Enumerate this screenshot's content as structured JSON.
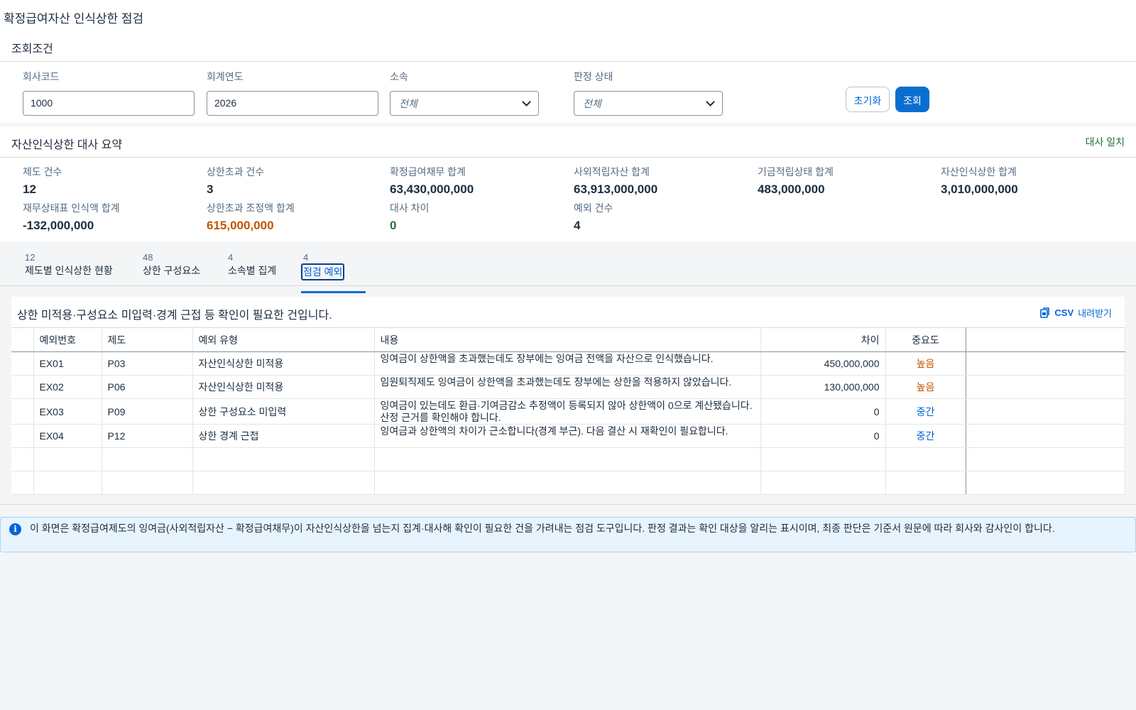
{
  "app": {
    "title": "확정급여자산 인식상한 점검"
  },
  "filters": {
    "heading": "조회조건",
    "company_code": {
      "label": "회사코드",
      "value": "1000"
    },
    "fiscal_year": {
      "label": "회계연도",
      "value": "2026"
    },
    "division": {
      "label": "소속",
      "value": "전체"
    },
    "status": {
      "label": "판정 상태",
      "value": "전체"
    },
    "reset_label": "초기화",
    "search_label": "조회"
  },
  "summary": {
    "heading": "자산인식상한 대사 요약",
    "status": "대사 일치",
    "kpis": [
      {
        "label": "제도 건수",
        "value": "12"
      },
      {
        "label": "상한초과 건수",
        "value": "3"
      },
      {
        "label": "확정급여채무 합계",
        "value": "63,430,000,000"
      },
      {
        "label": "사외적립자산 합계",
        "value": "63,913,000,000"
      },
      {
        "label": "기금적립상태 합계",
        "value": "483,000,000"
      },
      {
        "label": "자산인식상한 합계",
        "value": "3,010,000,000"
      },
      {
        "label": "재무상태표 인식액 합계",
        "value": "-132,000,000"
      },
      {
        "label": "상한초과 조정액 합계",
        "value": "615,000,000"
      },
      {
        "label": "대사 차이",
        "value": "0"
      },
      {
        "label": "예외 건수",
        "value": "4"
      }
    ]
  },
  "tabs": [
    {
      "count": "12",
      "label": "제도별 인식상한 현황"
    },
    {
      "count": "48",
      "label": "상한 구성요소"
    },
    {
      "count": "4",
      "label": "소속별 집계"
    },
    {
      "count": "4",
      "label": "점검 예외"
    }
  ],
  "exceptions": {
    "description": "상한 미적용·구성요소 미입력·경계 근접 등 확인이 필요한 건입니다.",
    "csv_icon_label": "CSV",
    "csv_label": "내려받기",
    "columns": [
      "예외번호",
      "제도",
      "예외 유형",
      "내용",
      "차이",
      "중요도"
    ],
    "rows": [
      {
        "id": "EX01",
        "plan": "P03",
        "type": "자산인식상한 미적용",
        "content": "잉여금이 상한액을 초과했는데도 장부에는 잉여금 전액을 자산으로 인식했습니다.",
        "diff": "450,000,000",
        "severity": "높음"
      },
      {
        "id": "EX02",
        "plan": "P06",
        "type": "자산인식상한 미적용",
        "content": "임원퇴직제도 잉여금이 상한액을 초과했는데도 장부에는 상한을 적용하지 않았습니다.",
        "diff": "130,000,000",
        "severity": "높음"
      },
      {
        "id": "EX03",
        "plan": "P09",
        "type": "상한 구성요소 미입력",
        "content": "잉여금이 있는데도 환급·기여금감소 추정액이 등록되지 않아 상한액이 0으로 계산됐습니다. 산정 근거를 확인해야 합니다.",
        "diff": "0",
        "severity": "중간"
      },
      {
        "id": "EX04",
        "plan": "P12",
        "type": "상한 경계 근접",
        "content": "잉여금과 상한액의 차이가 근소합니다(경계 부근). 다음 결산 시 재확인이 필요합니다.",
        "diff": "0",
        "severity": "중간"
      }
    ]
  },
  "notice": {
    "icon": "info-icon",
    "text": "이 화면은 확정급여제도의 잉여금(사외적립자산 − 확정급여채무)이 자산인식상한을 넘는지 집계·대사해 확인이 필요한 건을 가려내는 점검 도구입니다. 판정 결과는 확인 대상을 알리는 표시이며, 최종 판단은 기준서 원문에 따라 회사와 감사인이 합니다."
  }
}
